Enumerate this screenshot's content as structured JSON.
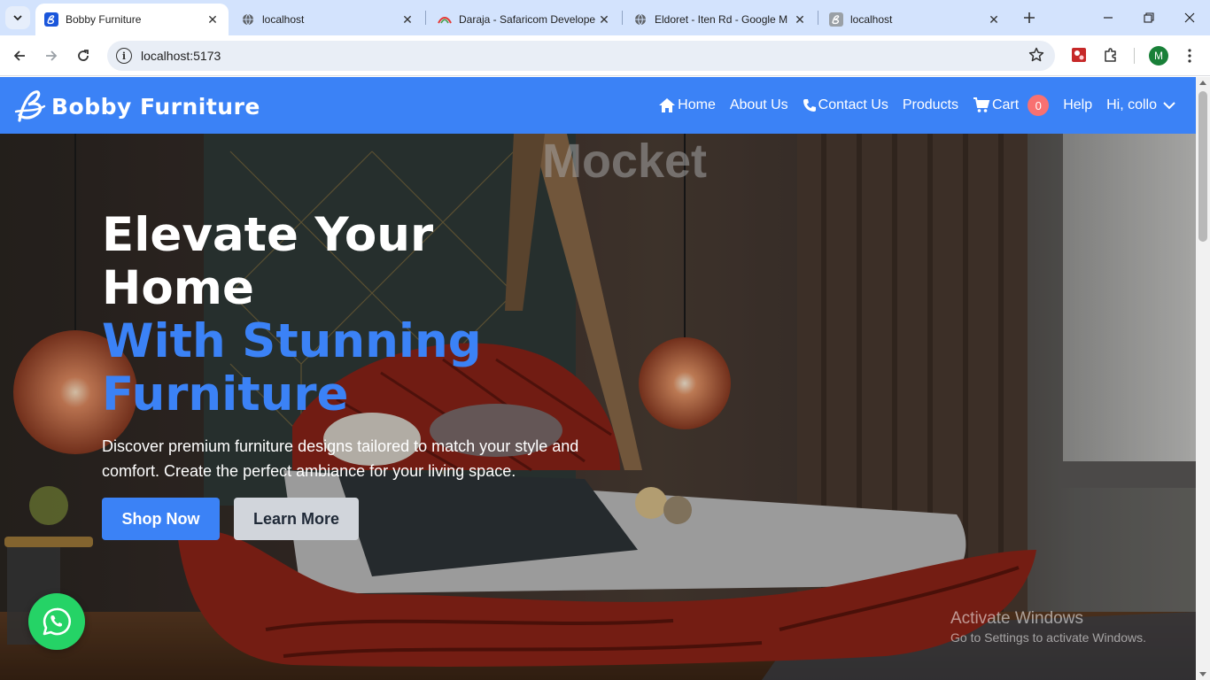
{
  "browser": {
    "tabs": [
      {
        "title": "Bobby Furniture",
        "favicon": "bobby-logo-icon",
        "active": true
      },
      {
        "title": "localhost",
        "favicon": "globe-icon",
        "active": false
      },
      {
        "title": "Daraja - Safaricom Develope",
        "favicon": "daraja-icon",
        "active": false
      },
      {
        "title": "Eldoret - Iten Rd - Google M",
        "favicon": "globe-icon",
        "active": false
      },
      {
        "title": "localhost",
        "favicon": "bobby-logo-icon",
        "active": false
      }
    ],
    "url": "localhost:5173",
    "profile_initial": "M"
  },
  "site": {
    "brand": "Bobby Furniture",
    "nav": {
      "home": "Home",
      "about": "About Us",
      "contact": "Contact Us",
      "products": "Products",
      "cart": "Cart",
      "cart_count": "0",
      "help": "Help",
      "user": "Hi, collo"
    },
    "hero": {
      "title_line1": "Elevate Your",
      "title_line2": "Home",
      "title_line3": "With Stunning",
      "title_line4": "Furniture",
      "description": "Discover premium furniture designs tailored to match your style and comfort. Create the perfect ambiance for your living space.",
      "shop_now": "Shop Now",
      "learn_more": "Learn More",
      "watermark": "Mocket"
    }
  },
  "os_overlay": {
    "line1": "Activate Windows",
    "line2": "Go to Settings to activate Windows."
  },
  "colors": {
    "brand_blue": "#3b82f6",
    "cart_badge": "#f87171",
    "whatsapp": "#25d366",
    "tabstrip": "#d3e3fd"
  }
}
